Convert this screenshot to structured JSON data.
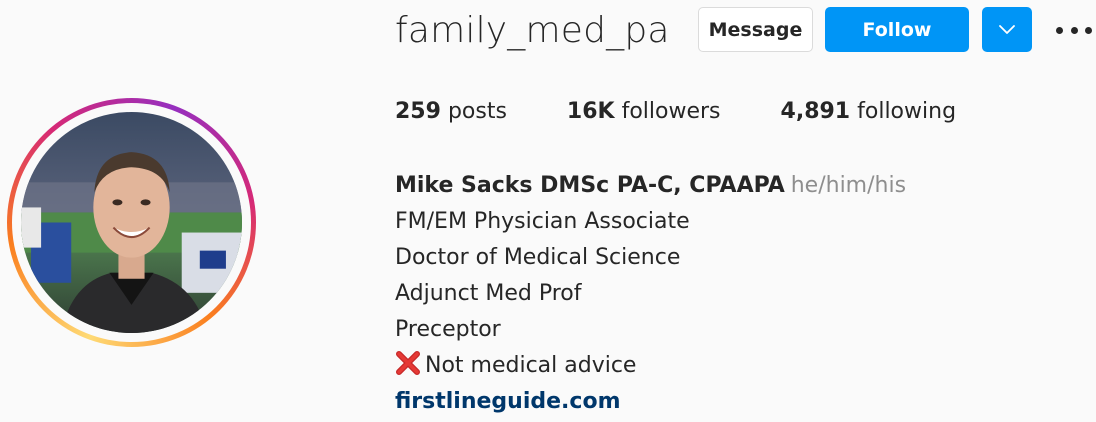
{
  "profile": {
    "username": "family_med_pa",
    "avatar_icon": "profile-photo",
    "ring_colors": [
      "#feda75",
      "#fa7e1e",
      "#d62976",
      "#962fbf"
    ]
  },
  "actions": {
    "message_label": "Message",
    "follow_label": "Follow",
    "more_icon": "chevron-down-icon",
    "options_icon": "more-horizontal-icon",
    "accent": "#0095f6"
  },
  "stats": {
    "posts_count": "259",
    "posts_label": "posts",
    "followers_count": "16K",
    "followers_label": "followers",
    "following_count": "4,891",
    "following_label": "following"
  },
  "bio": {
    "full_name": "Mike Sacks DMSc PA-C, CPAAPA",
    "pronouns": "he/him/his",
    "lines": [
      "FM/EM Physician Associate",
      "Doctor of Medical Science",
      "Adjunct Med Prof",
      "Preceptor"
    ],
    "disclaimer_icon": "cross-mark-icon",
    "disclaimer": "Not medical advice",
    "website": "firstlineguide.com",
    "link_color": "#00376b"
  }
}
